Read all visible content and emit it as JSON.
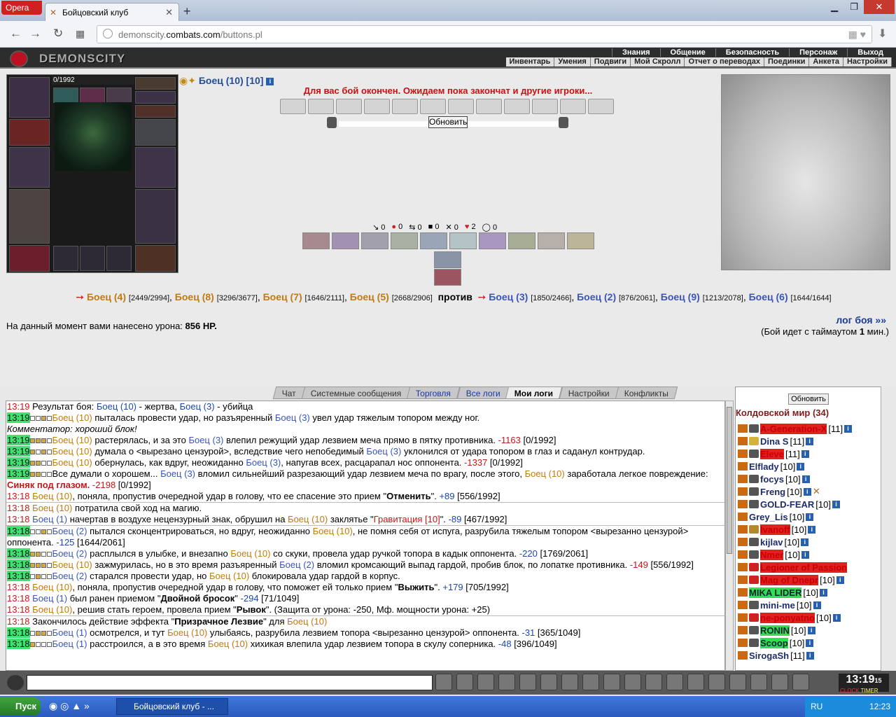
{
  "browser": {
    "menu_label": "Opera",
    "tab_title": "Бойцовский клуб",
    "url_prefix": "demonscity.",
    "url_host": "combats.com",
    "url_path": "/buttons.pl"
  },
  "header": {
    "logo": "DEMONSCITY",
    "menu_top": [
      "Знания",
      "Общение",
      "Безопасность",
      "Персонаж",
      "Выход"
    ],
    "menu_bottom": [
      "Инвентарь",
      "Умения",
      "Подвиги",
      "Мой Скролл",
      "Отчет о переводах",
      "Поединки",
      "Анкета",
      "Настройки"
    ]
  },
  "character": {
    "hp": "0/1992",
    "name": "Боец (10)",
    "level": "[10]"
  },
  "battle": {
    "message": "Для вас бой окончен. Ожидаем пока закончат и другие игроки...",
    "refresh": "Обновить",
    "stats": [
      "0",
      "0",
      "0",
      "0",
      "0",
      "2",
      "0"
    ],
    "team1": [
      {
        "name": "Боец (4)",
        "hp": "[2449/2994]"
      },
      {
        "name": "Боец (8)",
        "hp": "[3296/3677]"
      },
      {
        "name": "Боец (7)",
        "hp": "[1646/2111]"
      },
      {
        "name": "Боец (5)",
        "hp": "[2668/2906]"
      }
    ],
    "vs": "против",
    "team2": [
      {
        "name": "Боец (3)",
        "hp": "[1850/2466]"
      },
      {
        "name": "Боец (2)",
        "hp": "[876/2061]"
      },
      {
        "name": "Боец (9)",
        "hp": "[1213/2078]"
      },
      {
        "name": "Боец (6)",
        "hp": "[1644/1644]"
      }
    ],
    "damage_label": "На данный момент вами нанесено урона:",
    "damage_value": "856 HP.",
    "log_link": "лог боя »»",
    "timeout_pre": "(Бой идет с таймаутом ",
    "timeout_num": "1",
    "timeout_post": " мин.)"
  },
  "chat_tabs": [
    "Чат",
    "Системные сообщения",
    "Торговля",
    "Все логи",
    "Мои логи",
    "Настройки",
    "Конфликты"
  ],
  "userlist": {
    "refresh": "Обновить",
    "title": "Колдовской мир (34)",
    "users": [
      {
        "name": "A-Generation-X",
        "lvl": "[11]"
      },
      {
        "name": "Dina S",
        "lvl": "[11]"
      },
      {
        "name": "Eleve",
        "lvl": "[11]"
      },
      {
        "name": "Elflady",
        "lvl": "[10]"
      },
      {
        "name": "focys",
        "lvl": "[10]"
      },
      {
        "name": "Freng",
        "lvl": "[10]"
      },
      {
        "name": "GOLD-FEAR",
        "lvl": "[10]"
      },
      {
        "name": "Grey_Lis",
        "lvl": "[10]"
      },
      {
        "name": "Ivanoff",
        "lvl": "[10]"
      },
      {
        "name": "kijlav",
        "lvl": "[10]"
      },
      {
        "name": "Nmer",
        "lvl": "[10]"
      },
      {
        "name": "Legioner of Passion",
        "lvl": ""
      },
      {
        "name": "Mag of Dnepr",
        "lvl": "[10]"
      },
      {
        "name": "MIKA LIDER",
        "lvl": "[10]"
      },
      {
        "name": "mini-me",
        "lvl": "[10]"
      },
      {
        "name": "ne-ponyatno",
        "lvl": "[10]"
      },
      {
        "name": "RONIN",
        "lvl": "[10]"
      },
      {
        "name": "Scoop",
        "lvl": "[10]"
      },
      {
        "name": "SirogaSh",
        "lvl": "[11]"
      }
    ]
  },
  "clock": {
    "time": "13:19",
    "seconds": "15",
    "label1": "CLOCK",
    "label2": "TIMER"
  },
  "taskbar": {
    "start": "Пуск",
    "app": "Бойцовский клуб - ...",
    "lang": "RU",
    "time": "12:23"
  }
}
